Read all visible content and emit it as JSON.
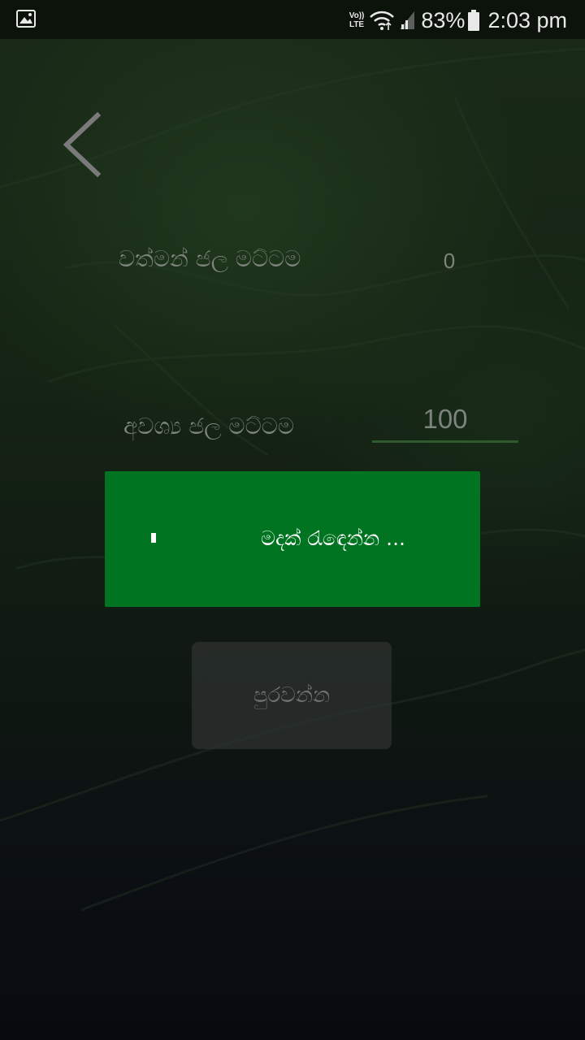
{
  "status_bar": {
    "volte_top": "Vo))",
    "volte_bottom": "LTE",
    "battery": "83%",
    "time": "2:03 pm",
    "icons": [
      "gallery-icon",
      "wifi-icon",
      "signal-icon",
      "battery-icon"
    ]
  },
  "form": {
    "current_level_label": "වත්මන් ජල මට්ටම",
    "current_level_value": "0",
    "required_level_label": "අවශ්‍ය ජල මට්ටම",
    "required_level_value": "100"
  },
  "progress_dialog": {
    "message": "මදක් රැඳෙන්න ..."
  },
  "complete_button_label": "පුරවන්න",
  "colors": {
    "progress_bg": "#007421",
    "input_underline": "#2e5a2c",
    "muted_text": "#7d847c"
  }
}
